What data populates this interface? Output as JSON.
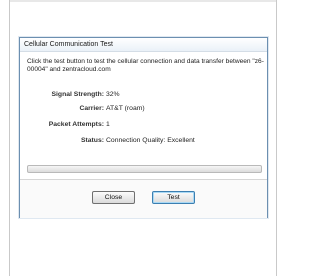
{
  "dialog": {
    "title": "Cellular Communication Test",
    "intro": "Click the test button to test the cellular connection and data transfer between \"z6-00004\" and zentracloud.com"
  },
  "fields": {
    "signal_strength": {
      "label": "Signal Strength:",
      "value": "32%"
    },
    "carrier": {
      "label": "Carrier:",
      "value": "AT&T (roam)"
    },
    "packet_attempts": {
      "label": "Packet Attempts:",
      "value": "1"
    },
    "status": {
      "label": "Status:",
      "value": "Connection Quality: Excellent"
    }
  },
  "progress": {
    "fraction": 0
  },
  "buttons": {
    "close_label": "Close",
    "test_label": "Test"
  }
}
